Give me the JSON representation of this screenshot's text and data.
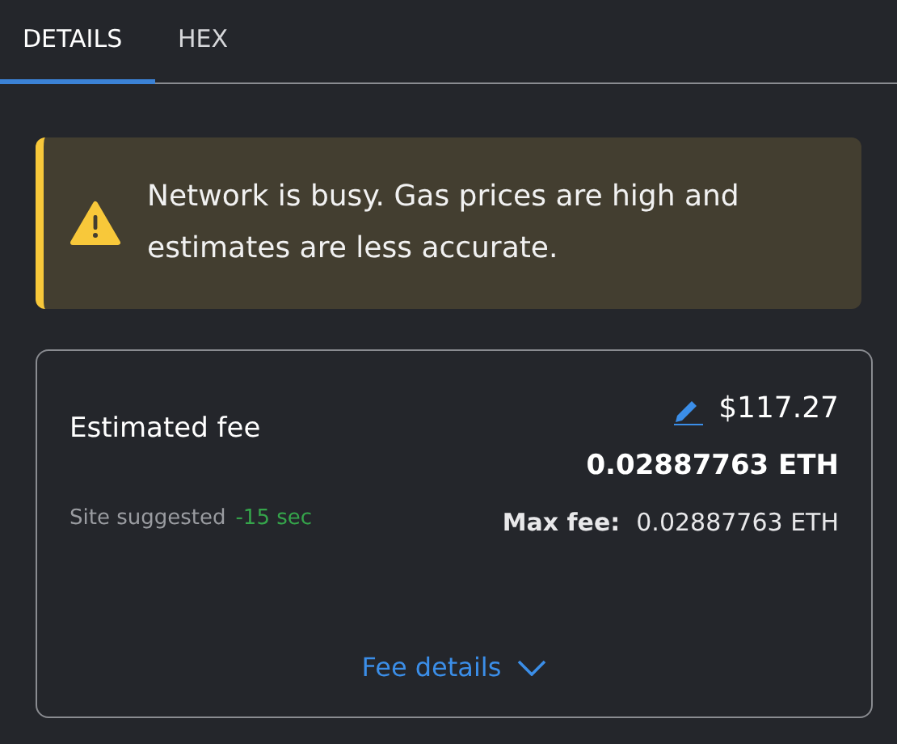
{
  "tabs": [
    {
      "label": "DETAILS",
      "selected": true
    },
    {
      "label": "HEX",
      "selected": false
    }
  ],
  "alert": {
    "text": "Network is busy. Gas prices are high and estimates are less accurate."
  },
  "fee": {
    "label": "Estimated fee",
    "fiat": "$117.27",
    "amount": "0.02887763 ETH",
    "source": "Site suggested",
    "time": "-15 sec",
    "max_label": "Max fee:",
    "max_value": "0.02887763 ETH",
    "details_link": "Fee details"
  }
}
